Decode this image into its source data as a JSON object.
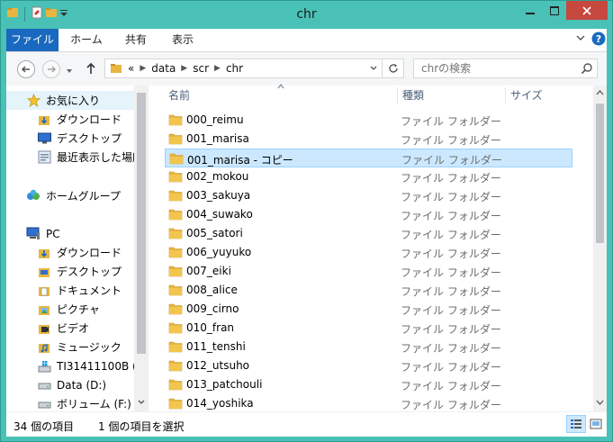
{
  "window": {
    "title": "chr"
  },
  "ribbon": {
    "tabs": [
      {
        "label": "ファイル"
      },
      {
        "label": "ホーム"
      },
      {
        "label": "共有"
      },
      {
        "label": "表示"
      }
    ]
  },
  "address": {
    "overflow": "«",
    "crumbs": [
      "data",
      "scr",
      "chr"
    ]
  },
  "search": {
    "placeholder": "chrの検索"
  },
  "columns": {
    "name": "名前",
    "type": "種類",
    "size": "サイズ"
  },
  "nav": {
    "favorites": "お気に入り",
    "fav_items": [
      "ダウンロード",
      "デスクトップ",
      "最近表示した場所"
    ],
    "homegroup": "ホームグループ",
    "pc": "PC",
    "pc_items": [
      "ダウンロード",
      "デスクトップ",
      "ドキュメント",
      "ピクチャ",
      "ビデオ",
      "ミュージック",
      "TI31411100B (C",
      "Data (D:)",
      "ボリューム (F:)"
    ]
  },
  "files": [
    {
      "name": "000_reimu",
      "type": "ファイル フォルダー"
    },
    {
      "name": "001_marisa",
      "type": "ファイル フォルダー"
    },
    {
      "name": "001_marisa - コピー",
      "type": "ファイル フォルダー",
      "selected": true
    },
    {
      "name": "002_mokou",
      "type": "ファイル フォルダー"
    },
    {
      "name": "003_sakuya",
      "type": "ファイル フォルダー"
    },
    {
      "name": "004_suwako",
      "type": "ファイル フォルダー"
    },
    {
      "name": "005_satori",
      "type": "ファイル フォルダー"
    },
    {
      "name": "006_yuyuko",
      "type": "ファイル フォルダー"
    },
    {
      "name": "007_eiki",
      "type": "ファイル フォルダー"
    },
    {
      "name": "008_alice",
      "type": "ファイル フォルダー"
    },
    {
      "name": "009_cirno",
      "type": "ファイル フォルダー"
    },
    {
      "name": "010_fran",
      "type": "ファイル フォルダー"
    },
    {
      "name": "011_tenshi",
      "type": "ファイル フォルダー"
    },
    {
      "name": "012_utsuho",
      "type": "ファイル フォルダー"
    },
    {
      "name": "013_patchouli",
      "type": "ファイル フォルダー"
    },
    {
      "name": "014_yoshika",
      "type": "ファイル フォルダー"
    }
  ],
  "status": {
    "count": "34 個の項目",
    "selection": "1 個の項目を選択"
  },
  "colors": {
    "accent": "#1a69c0",
    "frame": "#49c1b6",
    "close": "#c7483f",
    "selection": "#cce8ff",
    "folder": "#e8b640"
  }
}
